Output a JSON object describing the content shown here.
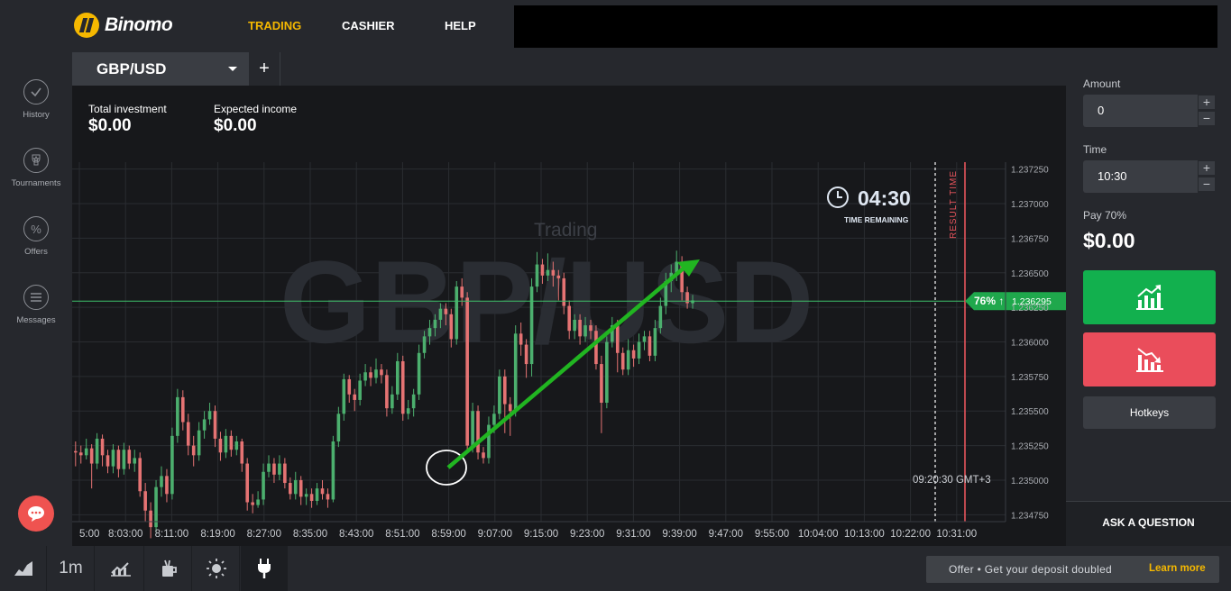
{
  "app": {
    "logo_text": "Binomo",
    "brand_color": "#f5b800"
  },
  "nav": {
    "trading": "TRADING",
    "cashier": "CASHIER",
    "help": "HELP"
  },
  "sidebar": {
    "items": [
      {
        "label": "History",
        "icon": "check-circle-icon"
      },
      {
        "label": "Tournaments",
        "icon": "trophy-icon"
      },
      {
        "label": "Offers",
        "icon": "percent-icon"
      },
      {
        "label": "Messages",
        "icon": "menu-lines-icon"
      }
    ]
  },
  "pair": {
    "name": "GBP/USD",
    "add_label": "+"
  },
  "investment": {
    "total_label": "Total investment",
    "total_value": "$0.00",
    "income_label": "Expected income",
    "income_value": "$0.00"
  },
  "chart": {
    "watermark": "GBP/USD",
    "mode_label": "Trading",
    "timer": "04:30",
    "timer_label": "TIME REMAINING",
    "result_label": "RESULT TIME",
    "current_time": "09:20:30 GMT+3",
    "price_badge_pct": "76% ↑",
    "price_badge_value": "1.236295",
    "up_color": "#4caf6e",
    "down_color": "#e57373"
  },
  "chart_data": {
    "type": "candlestick",
    "y_ticks": [
      "1.237250",
      "1.237000",
      "1.236750",
      "1.236500",
      "1.236250",
      "1.236000",
      "1.235750",
      "1.235500",
      "1.235250",
      "1.235000",
      "1.234750"
    ],
    "x_ticks": [
      "5:00",
      "8:03:00",
      "8:11:00",
      "8:19:00",
      "8:27:00",
      "8:35:00",
      "8:43:00",
      "8:51:00",
      "8:59:00",
      "9:07:00",
      "9:15:00",
      "9:23:00",
      "9:31:00",
      "9:39:00",
      "9:47:00",
      "9:55:00",
      "10:04:00",
      "10:13:00",
      "10:22:00",
      "10:31:00"
    ],
    "ylim": [
      1.2347,
      1.2373
    ],
    "current_price": 1.236295,
    "candles": [
      [
        1.23521,
        1.2352,
        1.23528,
        1.2351
      ],
      [
        1.2352,
        1.23518,
        1.23525,
        1.23512
      ],
      [
        1.23518,
        1.23523,
        1.2353,
        1.23515
      ],
      [
        1.23523,
        1.23512,
        1.23526,
        1.23494
      ],
      [
        1.23512,
        1.2353,
        1.23534,
        1.23508
      ],
      [
        1.2353,
        1.23518,
        1.23533,
        1.2351
      ],
      [
        1.23518,
        1.2351,
        1.23522,
        1.23505
      ],
      [
        1.2351,
        1.23522,
        1.23526,
        1.23505
      ],
      [
        1.23522,
        1.23508,
        1.23525,
        1.23502
      ],
      [
        1.23508,
        1.23522,
        1.23527,
        1.23504
      ],
      [
        1.23522,
        1.23512,
        1.23525,
        1.23508
      ],
      [
        1.23512,
        1.23516,
        1.23522,
        1.23506
      ],
      [
        1.23516,
        1.23492,
        1.2352,
        1.23488
      ],
      [
        1.23492,
        1.23478,
        1.23498,
        1.2347
      ],
      [
        1.23478,
        1.23466,
        1.23484,
        1.23458
      ],
      [
        1.23466,
        1.23495,
        1.235,
        1.23462
      ],
      [
        1.23495,
        1.23503,
        1.2351,
        1.23488
      ],
      [
        1.23503,
        1.2349,
        1.23508,
        1.23484
      ],
      [
        1.2349,
        1.23532,
        1.23538,
        1.23486
      ],
      [
        1.23532,
        1.2356,
        1.23566,
        1.23527
      ],
      [
        1.2356,
        1.23542,
        1.23565,
        1.23536
      ],
      [
        1.23542,
        1.23525,
        1.23548,
        1.23518
      ],
      [
        1.23525,
        1.23518,
        1.23532,
        1.2351
      ],
      [
        1.23518,
        1.23536,
        1.23542,
        1.23514
      ],
      [
        1.23536,
        1.23544,
        1.2355,
        1.2353
      ],
      [
        1.23544,
        1.2355,
        1.23556,
        1.2354
      ],
      [
        1.2355,
        1.2353,
        1.23554,
        1.23524
      ],
      [
        1.2353,
        1.2352,
        1.23535,
        1.23514
      ],
      [
        1.2352,
        1.23532,
        1.23537,
        1.23516
      ],
      [
        1.23532,
        1.23522,
        1.23536,
        1.23517
      ],
      [
        1.23522,
        1.23528,
        1.23532,
        1.23518
      ],
      [
        1.23528,
        1.23512,
        1.2353,
        1.23506
      ],
      [
        1.23512,
        1.23484,
        1.23516,
        1.23478
      ],
      [
        1.23484,
        1.23482,
        1.2349,
        1.23476
      ],
      [
        1.23482,
        1.23486,
        1.23492,
        1.2348
      ],
      [
        1.23486,
        1.23506,
        1.23512,
        1.23482
      ],
      [
        1.23506,
        1.23512,
        1.23518,
        1.23502
      ],
      [
        1.23512,
        1.23504,
        1.23516,
        1.23498
      ],
      [
        1.23504,
        1.23512,
        1.23518,
        1.235
      ],
      [
        1.23512,
        1.23498,
        1.23516,
        1.23494
      ],
      [
        1.23498,
        1.2349,
        1.23502,
        1.23486
      ],
      [
        1.2349,
        1.235,
        1.23506,
        1.23486
      ],
      [
        1.235,
        1.23488,
        1.23503,
        1.23482
      ],
      [
        1.23488,
        1.2349,
        1.23494,
        1.23482
      ],
      [
        1.2349,
        1.23485,
        1.23494,
        1.2348
      ],
      [
        1.23485,
        1.23494,
        1.23498,
        1.23482
      ],
      [
        1.23494,
        1.2349,
        1.235,
        1.23486
      ],
      [
        1.2349,
        1.23486,
        1.23494,
        1.2348
      ],
      [
        1.23486,
        1.23528,
        1.23532,
        1.23484
      ],
      [
        1.23528,
        1.23548,
        1.23553,
        1.23524
      ],
      [
        1.23548,
        1.23573,
        1.23577,
        1.23543
      ],
      [
        1.23573,
        1.23562,
        1.23576,
        1.23556
      ],
      [
        1.23562,
        1.23558,
        1.23566,
        1.2355
      ],
      [
        1.23558,
        1.23572,
        1.23577,
        1.23554
      ],
      [
        1.23572,
        1.23578,
        1.23584,
        1.23568
      ],
      [
        1.23578,
        1.23574,
        1.23582,
        1.23568
      ],
      [
        1.23574,
        1.2358,
        1.23588,
        1.2357
      ],
      [
        1.2358,
        1.23576,
        1.23584,
        1.2357
      ],
      [
        1.23576,
        1.23552,
        1.2358,
        1.23546
      ],
      [
        1.23552,
        1.23562,
        1.23568,
        1.23548
      ],
      [
        1.23562,
        1.23586,
        1.23592,
        1.23558
      ],
      [
        1.23586,
        1.23548,
        1.2359,
        1.23543
      ],
      [
        1.23548,
        1.23552,
        1.23558,
        1.23544
      ],
      [
        1.23552,
        1.23562,
        1.23566,
        1.23546
      ],
      [
        1.23562,
        1.23592,
        1.23598,
        1.23558
      ],
      [
        1.23592,
        1.23604,
        1.23608,
        1.23588
      ],
      [
        1.23604,
        1.2361,
        1.23616,
        1.23598
      ],
      [
        1.2361,
        1.23616,
        1.2362,
        1.23604
      ],
      [
        1.23616,
        1.23624,
        1.23628,
        1.2361
      ],
      [
        1.23624,
        1.2362,
        1.23628,
        1.23612
      ],
      [
        1.2362,
        1.23602,
        1.23624,
        1.23596
      ],
      [
        1.23602,
        1.2364,
        1.23644,
        1.23598
      ],
      [
        1.2364,
        1.23632,
        1.23646,
        1.23626
      ],
      [
        1.23632,
        1.23525,
        1.23636,
        1.2352
      ],
      [
        1.23525,
        1.2355,
        1.23556,
        1.2352
      ],
      [
        1.2355,
        1.2352,
        1.23554,
        1.23515
      ],
      [
        1.2352,
        1.23516,
        1.23524,
        1.23512
      ],
      [
        1.23516,
        1.2354,
        1.23546,
        1.23512
      ],
      [
        1.2354,
        1.23548,
        1.23554,
        1.23534
      ],
      [
        1.23548,
        1.23575,
        1.2358,
        1.23544
      ],
      [
        1.23575,
        1.23555,
        1.2358,
        1.23534
      ],
      [
        1.23555,
        1.2355,
        1.2356,
        1.23532
      ],
      [
        1.2355,
        1.23606,
        1.23612,
        1.23546
      ],
      [
        1.23606,
        1.23598,
        1.23614,
        1.2359
      ],
      [
        1.23598,
        1.23584,
        1.23602,
        1.23574
      ],
      [
        1.23584,
        1.2364,
        1.23646,
        1.23575
      ],
      [
        1.2364,
        1.23656,
        1.23665,
        1.23636
      ],
      [
        1.23656,
        1.23648,
        1.2366,
        1.23642
      ],
      [
        1.23648,
        1.23652,
        1.23664,
        1.23644
      ],
      [
        1.23652,
        1.23648,
        1.23658,
        1.2364
      ],
      [
        1.23648,
        1.23646,
        1.23652,
        1.2363
      ],
      [
        1.23646,
        1.23626,
        1.2365,
        1.2362
      ],
      [
        1.23626,
        1.23608,
        1.2363,
        1.23602
      ],
      [
        1.23608,
        1.23616,
        1.2362,
        1.23602
      ],
      [
        1.23616,
        1.23604,
        1.2362,
        1.23598
      ],
      [
        1.23604,
        1.23612,
        1.23618,
        1.236
      ],
      [
        1.23612,
        1.23608,
        1.23616,
        1.23602
      ],
      [
        1.23608,
        1.23584,
        1.23612,
        1.2358
      ],
      [
        1.23584,
        1.23556,
        1.2359,
        1.23534
      ],
      [
        1.23556,
        1.236,
        1.23604,
        1.23552
      ],
      [
        1.236,
        1.23612,
        1.23618,
        1.23596
      ],
      [
        1.23612,
        1.23592,
        1.23616,
        1.23578
      ],
      [
        1.23592,
        1.2358,
        1.23596,
        1.23576
      ],
      [
        1.2358,
        1.23594,
        1.23602,
        1.23576
      ],
      [
        1.23594,
        1.23588,
        1.23598,
        1.23582
      ],
      [
        1.23588,
        1.236,
        1.23606,
        1.23584
      ],
      [
        1.236,
        1.23604,
        1.23608,
        1.23594
      ],
      [
        1.23604,
        1.2359,
        1.23608,
        1.23586
      ],
      [
        1.2359,
        1.2361,
        1.23616,
        1.23586
      ],
      [
        1.2361,
        1.23626,
        1.23632,
        1.23606
      ],
      [
        1.23626,
        1.23644,
        1.2365,
        1.2362
      ],
      [
        1.23644,
        1.2365,
        1.23656,
        1.23636
      ],
      [
        1.2365,
        1.23658,
        1.23666,
        1.23644
      ],
      [
        1.23658,
        1.23636,
        1.23662,
        1.2363
      ],
      [
        1.23636,
        1.23628,
        1.2364,
        1.23624
      ],
      [
        1.23628,
        1.2363,
        1.23634,
        1.23624
      ]
    ]
  },
  "panel": {
    "amount_label": "Amount",
    "amount_value": "0",
    "time_label": "Time",
    "time_value": "10:30",
    "plus": "+",
    "minus": "−",
    "pay_label": "Pay 70%",
    "pay_value": "$0.00",
    "hotkeys": "Hotkeys",
    "ask": "ASK A QUESTION"
  },
  "bottom": {
    "timeframe": "1m",
    "offer_text": "Offer • Get your deposit doubled",
    "offer_link": "Learn more"
  }
}
